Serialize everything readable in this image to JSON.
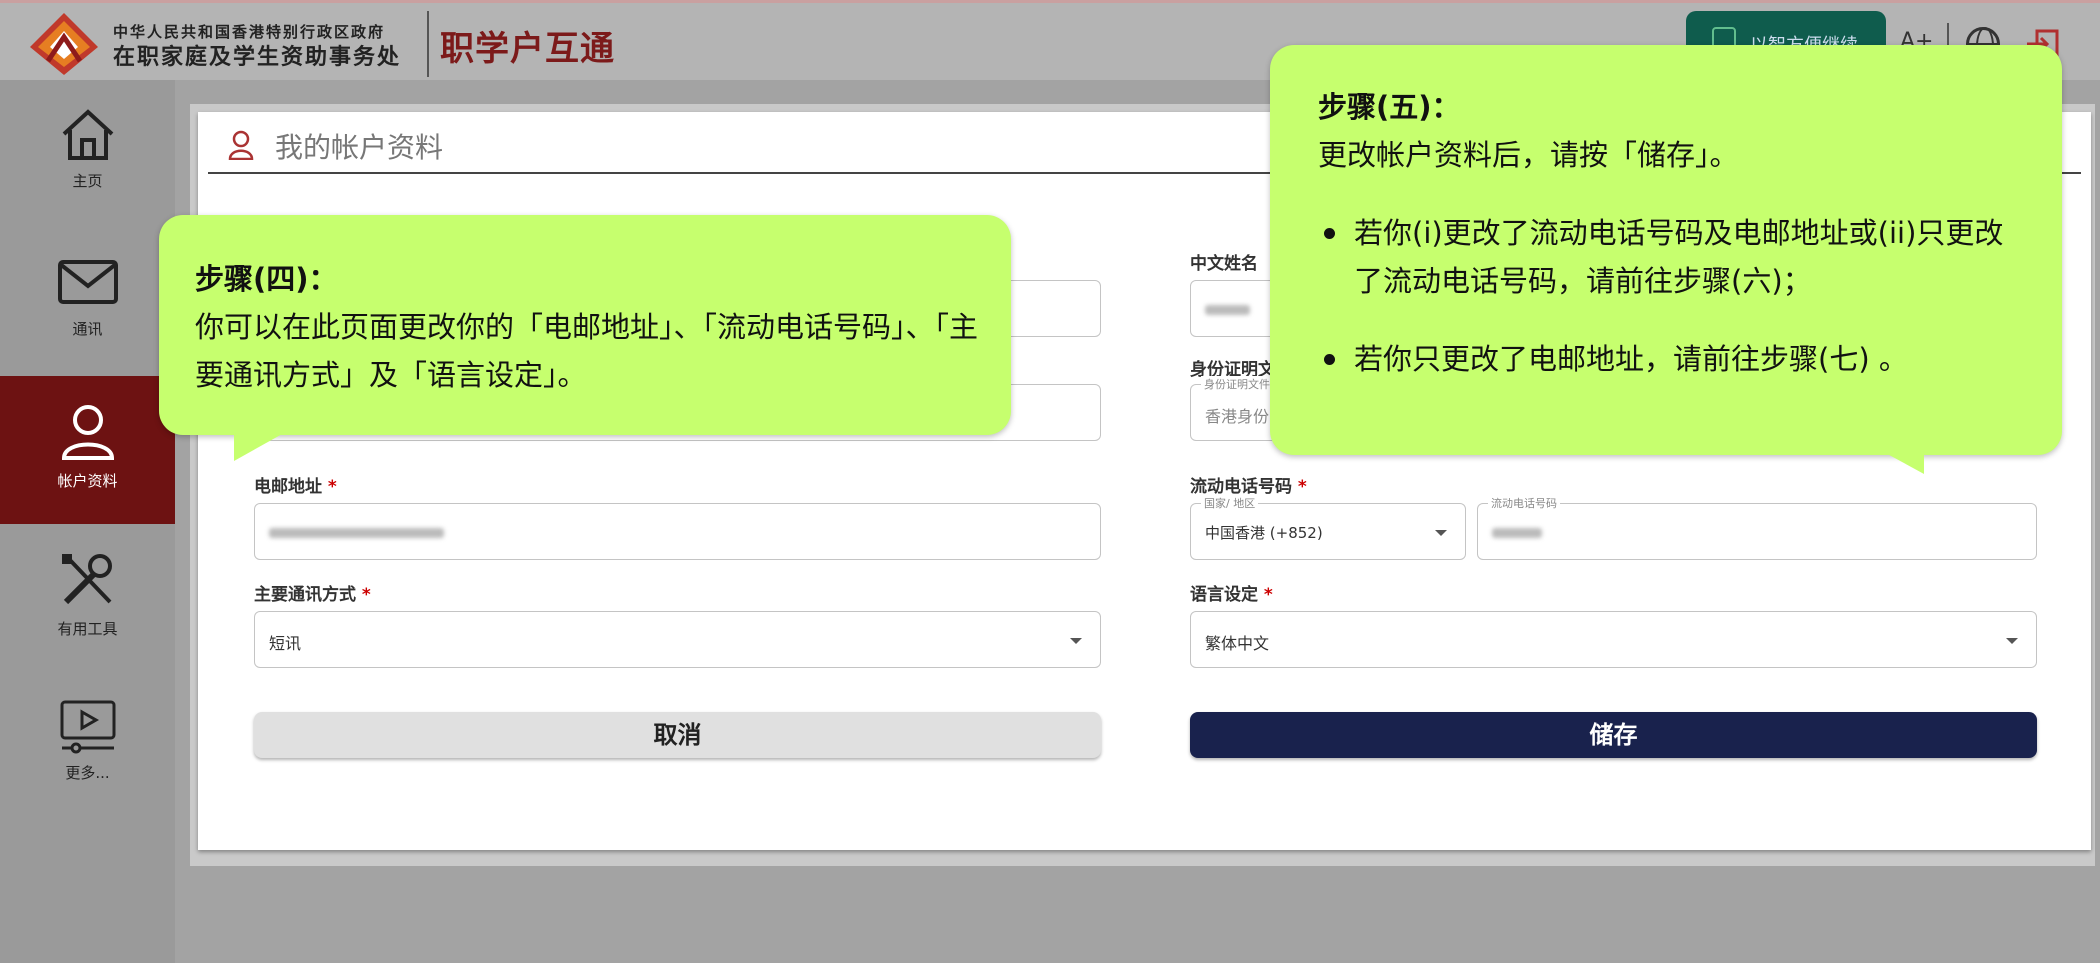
{
  "header": {
    "dept_line1": "中华人民共和国香港特别行政区政府",
    "dept_line2": "在职家庭及学生资助事务处",
    "app_name": "职学户互通",
    "iam_button": "以智方便继续",
    "font_size_button": "A+"
  },
  "sidebar": {
    "items": [
      {
        "label": "主页",
        "icon": "home-icon"
      },
      {
        "label": "通讯",
        "icon": "mail-icon"
      },
      {
        "label": "帐户资料",
        "icon": "user-icon"
      },
      {
        "label": "有用工具",
        "icon": "tools-icon"
      },
      {
        "label": "更多...",
        "icon": "video-icon"
      }
    ],
    "active_index": 2
  },
  "card": {
    "title": "我的帐户资料"
  },
  "form": {
    "chinese_name": {
      "label": "中文姓名"
    },
    "id_doc": {
      "label": "身份证明文",
      "float_label": "身份证明文件",
      "value": "香港身份"
    },
    "email": {
      "label": "电邮地址",
      "required": "*"
    },
    "mobile": {
      "label": "流动电话号码",
      "required": "*",
      "region_float_label": "国家/ 地区",
      "region_value": "中国香港 (+852)",
      "number_float_label": "流动电话号码"
    },
    "contact_method": {
      "label": "主要通讯方式",
      "required": "*",
      "value": "短讯"
    },
    "language": {
      "label": "语言设定",
      "required": "*",
      "value": "繁体中文"
    },
    "cancel_label": "取消",
    "save_label": "储存"
  },
  "callout_step4": {
    "heading": "步骤(四)：",
    "body": "你可以在此页面更改你的「电邮地址」、「流动电话号码」、「主要通讯方式」及「语言设定」。"
  },
  "callout_step5": {
    "heading": "步骤(五)：",
    "body": "更改帐户资料后，请按「储存」。",
    "bullets": [
      "若你(i)更改了流动电话号码及电邮地址或(ii)只更改了流动电话号码，请前往步骤(六)；",
      "若你只更改了电邮地址，请前往步骤(七) 。"
    ]
  },
  "colors": {
    "brand": "#7c1a1a",
    "sidebar_active": "#6d1212",
    "save_button": "#19224d",
    "callout": "#c6ff6e",
    "required": "#cc0000"
  }
}
